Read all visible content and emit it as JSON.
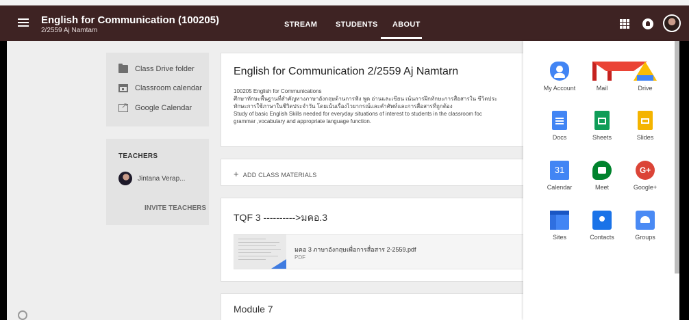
{
  "header": {
    "title": "English for Communication (100205)",
    "subtitle": "2/2559 Aj Namtam",
    "tabs": [
      {
        "label": "STREAM"
      },
      {
        "label": "STUDENTS"
      },
      {
        "label": "ABOUT",
        "active": true
      }
    ],
    "background_color": "#3e2323"
  },
  "sidebar": {
    "links": [
      {
        "label": "Class Drive folder",
        "icon": "folder-icon"
      },
      {
        "label": "Classroom calendar",
        "icon": "calendar-icon"
      },
      {
        "label": "Google Calendar",
        "icon": "external-link-icon"
      }
    ],
    "teachers_heading": "TEACHERS",
    "teacher_name": "Jintana Verap...",
    "invite_label": "INVITE TEACHERS"
  },
  "about": {
    "title": "English for Communication 2/2559 Aj Namtarn",
    "description_lines": [
      "100205 English for Communications",
      "ศึกษาทักษะพื้นฐานที่สำคัญทางภาษาอังกฤษด้านการฟัง พูด อ่านและเขียน เน้นการฝึกทักษะการสื่อสารใน ชีวิตประ",
      "ทักษะการใช้ภาษาในชีวิตประจำวัน โดยเน้นเรื่องไวยากรณ์และคำศัพท์และการสื่อสารที่ถูกต้อง",
      "Study of basic English Skills needed for everyday situations of interest to students in the classroom foc",
      "grammar ,vocabulary and appropriate language function."
    ]
  },
  "add_materials": {
    "label": "ADD CLASS MATERIALS"
  },
  "topics": [
    {
      "title": "TQF 3 ---------->มคอ.3",
      "attachment": {
        "name": "มคอ 3 ภาษาอังกฤษเพื่อการสื่อสาร 2-2559.pdf",
        "type": "PDF"
      }
    },
    {
      "title": "Module 7"
    }
  ],
  "apps_panel": {
    "apps": [
      {
        "label": "My Account",
        "icon": "my-account-icon"
      },
      {
        "label": "Mail",
        "icon": "gmail-icon"
      },
      {
        "label": "Drive",
        "icon": "drive-icon"
      },
      {
        "label": "Docs",
        "icon": "docs-icon"
      },
      {
        "label": "Sheets",
        "icon": "sheets-icon"
      },
      {
        "label": "Slides",
        "icon": "slides-icon"
      },
      {
        "label": "Calendar",
        "icon": "calendar-app-icon",
        "badge": "31"
      },
      {
        "label": "Meet",
        "icon": "meet-icon"
      },
      {
        "label": "Google+",
        "icon": "google-plus-icon",
        "badge": "G+"
      },
      {
        "label": "Sites",
        "icon": "sites-icon"
      },
      {
        "label": "Contacts",
        "icon": "contacts-icon"
      },
      {
        "label": "Groups",
        "icon": "groups-icon"
      }
    ]
  }
}
